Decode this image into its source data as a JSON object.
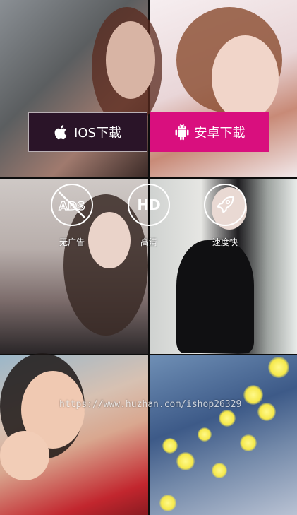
{
  "download": {
    "ios_label": "IOS下載",
    "android_label": "安卓下載",
    "ios_color": "#2a1428",
    "android_color": "#d90f7e"
  },
  "features": [
    {
      "icon": "no-ads-icon",
      "badge": "ADS",
      "label": "无广告"
    },
    {
      "icon": "hd-icon",
      "badge": "HD",
      "label": "高清"
    },
    {
      "icon": "rocket-icon",
      "label": "速度快"
    }
  ],
  "watermark": "https://www.huzhan.com/ishop26329",
  "photos": [
    {
      "icon": "photo-woman-street"
    },
    {
      "icon": "photo-woman-lying-pink"
    },
    {
      "icon": "photo-woman-black-dress"
    },
    {
      "icon": "photo-woman-black-dress-standing"
    },
    {
      "icon": "photo-woman-red-top-waving"
    },
    {
      "icon": "photo-woman-fairy-lights"
    }
  ]
}
